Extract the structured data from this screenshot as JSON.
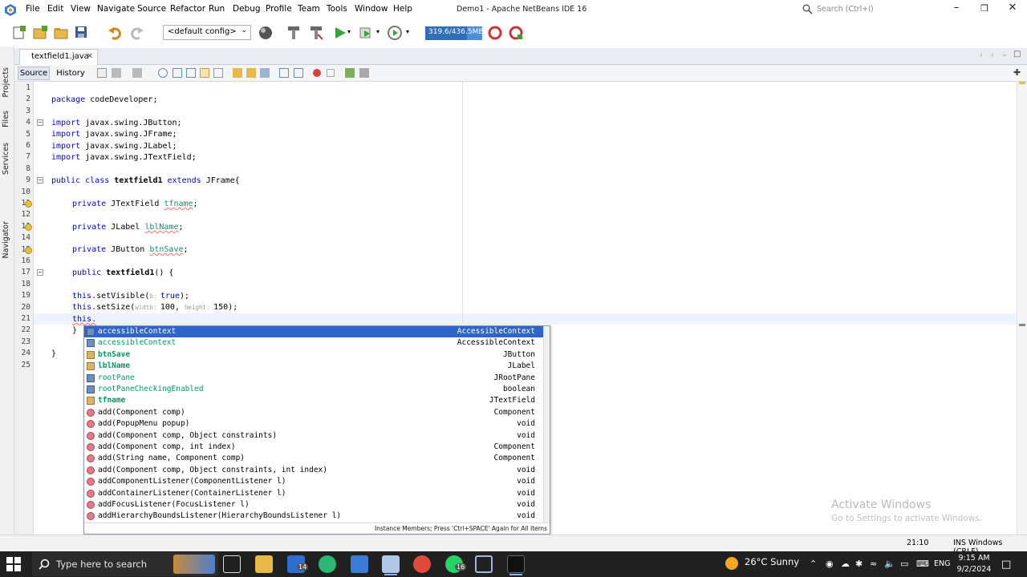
{
  "app": {
    "window_title": "Demo1 - Apache NetBeans IDE 16",
    "menu": [
      "File",
      "Edit",
      "View",
      "Navigate",
      "Source",
      "Refactor",
      "Run",
      "Debug",
      "Profile",
      "Team",
      "Tools",
      "Window",
      "Help"
    ],
    "search_placeholder": "Search (Ctrl+I)"
  },
  "toolbar": {
    "config": "<default config>",
    "memory": "319.6/436.5MB",
    "memory_fraction": 0.73
  },
  "side_panels": [
    "Projects",
    "Files",
    "Services",
    "Navigator"
  ],
  "editor": {
    "file_tab": "textfield1.java",
    "tab_source": "Source",
    "tab_history": "History",
    "line_numbers": [
      "1",
      "2",
      "3",
      "4",
      "5",
      "6",
      "7",
      "8",
      "9",
      "10",
      "11",
      "12",
      "13",
      "14",
      "15",
      "16",
      "17",
      "18",
      "19",
      "20",
      "21",
      "22",
      "23",
      "24",
      "25"
    ],
    "code": {
      "l2": "package codeDeveloper;",
      "l4_kw": "import",
      "l4": " javax.swing.JButton;",
      "l5_kw": "import",
      "l5": " javax.swing.JFrame;",
      "l6_kw": "import",
      "l6": " javax.swing.JLabel;",
      "l7_kw": "import",
      "l7": " javax.swing.JTextField;",
      "l9_kw1": "public class ",
      "l9_name": "textfield1",
      "l9_kw2": " extends ",
      "l9_rest": "JFrame{",
      "l11_kw": "private",
      "l11_type": " JTextField ",
      "l11_field": "tfname",
      "l11_end": ";",
      "l13_kw": "private",
      "l13_type": " JLabel ",
      "l13_field": "lblName",
      "l13_end": ";",
      "l15_kw": "private",
      "l15_type": " JButton ",
      "l15_field": "btnSave",
      "l15_end": ";",
      "l17_kw": "public",
      "l17_name": " textfield1",
      "l17_end": "() {",
      "l19_kw": "this",
      "l19_a": ".setVisible(",
      "l19_hint": "b: ",
      "l19_val": "true",
      "l19_end": ");",
      "l20_kw": "this",
      "l20_a": ".setSize(",
      "l20_hint1": "width: ",
      "l20_v1": "100, ",
      "l20_hint2": "height: ",
      "l20_v2": "150",
      "l20_end": ");",
      "l21": "this.",
      "l22": "}",
      "l24": "}"
    }
  },
  "completion": {
    "items": [
      {
        "name": "accessibleContext",
        "type": "AccessibleContext",
        "kind": "field",
        "selected": true
      },
      {
        "name": "accessibleContext",
        "type": "AccessibleContext",
        "kind": "field"
      },
      {
        "name": "btnSave",
        "type": "JButton",
        "kind": "bfield"
      },
      {
        "name": "lblName",
        "type": "JLabel",
        "kind": "bfield"
      },
      {
        "name": "rootPane",
        "type": "JRootPane",
        "kind": "field"
      },
      {
        "name": "rootPaneCheckingEnabled",
        "type": "boolean",
        "kind": "field"
      },
      {
        "name": "tfname",
        "type": "JTextField",
        "kind": "bfield"
      },
      {
        "name": "add(Component comp)",
        "type": "Component",
        "kind": "method",
        "params": [
          "comp"
        ]
      },
      {
        "name": "add(PopupMenu popup)",
        "type": "void",
        "kind": "method"
      },
      {
        "name": "add(Component comp, Object constraints)",
        "type": "void",
        "kind": "method"
      },
      {
        "name": "add(Component comp, int index)",
        "type": "Component",
        "kind": "method"
      },
      {
        "name": "add(String name, Component comp)",
        "type": "Component",
        "kind": "method"
      },
      {
        "name": "add(Component comp, Object constraints, int index)",
        "type": "void",
        "kind": "method"
      },
      {
        "name": "addComponentListener(ComponentListener l)",
        "type": "void",
        "kind": "method"
      },
      {
        "name": "addContainerListener(ContainerListener l)",
        "type": "void",
        "kind": "method"
      },
      {
        "name": "addFocusListener(FocusListener l)",
        "type": "void",
        "kind": "method"
      },
      {
        "name": "addHierarchyBoundsListener(HierarchyBoundsListener l)",
        "type": "void",
        "kind": "method"
      }
    ],
    "footer": "Instance Members; Press 'Ctrl+SPACE' Again for All Items"
  },
  "watermark": {
    "title": "Activate Windows",
    "subtitle": "Go to Settings to activate Windows."
  },
  "status": {
    "position": "21:10",
    "mode": "INS Windows (CRLF)"
  },
  "taskbar": {
    "search_placeholder": "Type here to search",
    "weather": "26°C  Sunny",
    "language": "ENG",
    "time": "9:15 AM",
    "date": "9/2/2024",
    "mail_badge": "14",
    "whatsapp_badge": "16"
  },
  "colors": {
    "selection": "#2f65ca",
    "keyword": "#0000e6",
    "field": "#009966",
    "taskbar": "#202020",
    "memory_bar": "#4d8fd6"
  }
}
